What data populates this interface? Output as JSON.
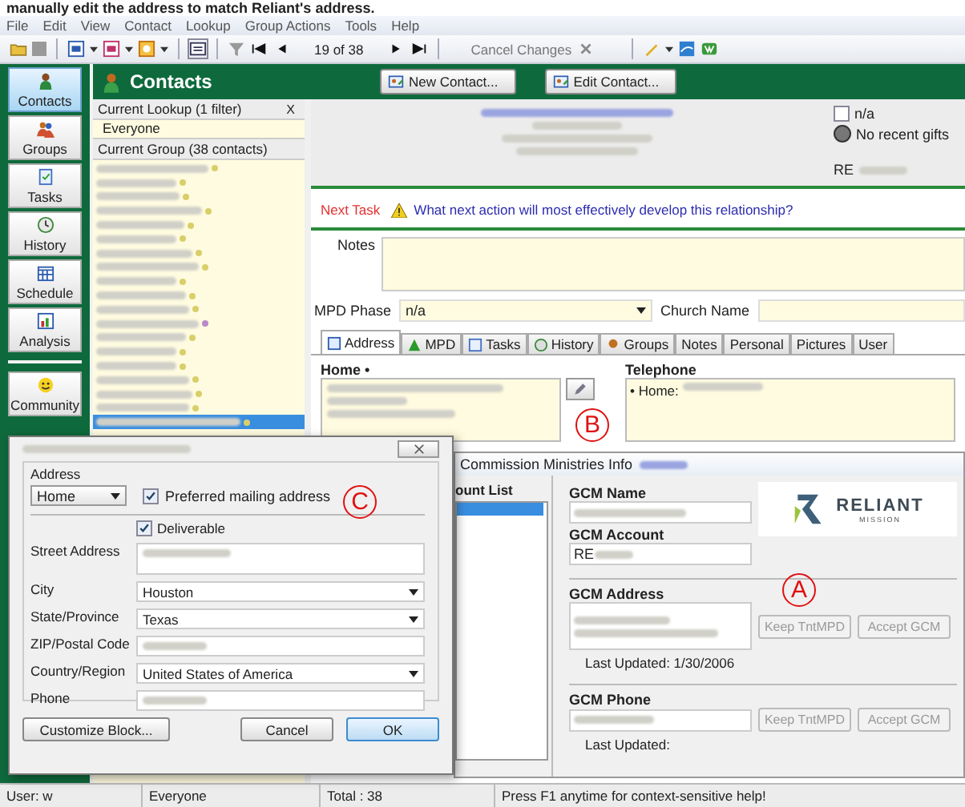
{
  "caption": "manually edit the address to match Reliant's address.",
  "menu": [
    "File",
    "Edit",
    "View",
    "Contact",
    "Lookup",
    "Group Actions",
    "Tools",
    "Help"
  ],
  "toolbar": {
    "record": "19 of 38",
    "cancel": "Cancel Changes"
  },
  "nav": [
    {
      "label": "Contacts",
      "selected": true
    },
    {
      "label": "Groups",
      "selected": false
    },
    {
      "label": "Tasks",
      "selected": false
    },
    {
      "label": "History",
      "selected": false
    },
    {
      "label": "Schedule",
      "selected": false
    },
    {
      "label": "Analysis",
      "selected": false
    },
    {
      "label": "Community",
      "selected": false
    }
  ],
  "header": {
    "title": "Contacts",
    "buttons": [
      "New Contact...",
      "Edit Contact..."
    ]
  },
  "lookup": {
    "title": "Current Lookup (1 filter)",
    "close": "X",
    "value": "Everyone",
    "group": "Current Group (38 contacts)",
    "rows": [
      {
        "color": "#d9cf6a",
        "selected": false
      },
      {
        "color": "#d9cf6a",
        "selected": false
      },
      {
        "color": "#d9cf6a",
        "selected": false
      },
      {
        "color": "#d9cf6a",
        "selected": false
      },
      {
        "color": "#d9cf6a",
        "selected": false
      },
      {
        "color": "#d9cf6a",
        "selected": false
      },
      {
        "color": "#d9cf6a",
        "selected": false
      },
      {
        "color": "#d9cf6a",
        "selected": false
      },
      {
        "color": "#d9cf6a",
        "selected": false
      },
      {
        "color": "#d9cf6a",
        "selected": false
      },
      {
        "color": "#d9cf6a",
        "selected": false
      },
      {
        "color": "#b98ac8",
        "selected": false
      },
      {
        "color": "#d9cf6a",
        "selected": false
      },
      {
        "color": "#d9cf6a",
        "selected": false
      },
      {
        "color": "#d9cf6a",
        "selected": false
      },
      {
        "color": "#d9cf6a",
        "selected": false
      },
      {
        "color": "#d9cf6a",
        "selected": false
      },
      {
        "color": "#d9cf6a",
        "selected": false
      },
      {
        "color": "#d9cf6a",
        "selected": true
      }
    ]
  },
  "summary": {
    "na_label": "n/a",
    "na_checked": false,
    "gifts": "No recent gifts",
    "account_prefix": "RE"
  },
  "next_task": {
    "label": "Next Task",
    "prompt": "What next action will most effectively develop this relationship?"
  },
  "notes_label": "Notes",
  "mpd": {
    "label": "MPD Phase",
    "value": "n/a",
    "church_label": "Church Name"
  },
  "tabs": [
    {
      "label": "Address",
      "selected": true
    },
    {
      "label": "MPD",
      "selected": false
    },
    {
      "label": "Tasks",
      "selected": false
    },
    {
      "label": "History",
      "selected": false
    },
    {
      "label": "Groups",
      "selected": false
    },
    {
      "label": "Notes",
      "selected": false
    },
    {
      "label": "Personal",
      "selected": false
    },
    {
      "label": "Pictures",
      "selected": false
    },
    {
      "label": "User",
      "selected": false
    }
  ],
  "address": {
    "heading": "Home •",
    "phone_heading": "Telephone",
    "phone_label": "• Home:"
  },
  "dialog": {
    "group_label": "Address",
    "type": "Home",
    "preferred": {
      "label": "Preferred mailing address",
      "checked": true
    },
    "deliverable": {
      "label": "Deliverable",
      "checked": true
    },
    "fields": [
      {
        "label": "Street Address",
        "kind": "multiline"
      },
      {
        "label": "City",
        "kind": "dropdown",
        "value": "Houston"
      },
      {
        "label": "State/Province",
        "kind": "dropdown",
        "value": "Texas"
      },
      {
        "label": "ZIP/Postal Code",
        "kind": "text"
      },
      {
        "label": "Country/Region",
        "kind": "dropdown",
        "value": "United States of America"
      },
      {
        "label": "Phone",
        "kind": "text"
      }
    ],
    "buttons": [
      "Customize Block...",
      "Cancel",
      "OK"
    ]
  },
  "gcm": {
    "title": "Commission Ministries Info",
    "list_title": "ount List",
    "name_label": "GCM Name",
    "account_label": "GCM Account",
    "account_prefix": "RE",
    "logo": "RELIANT",
    "logo_sub": "MISSION",
    "address_label": "GCM Address",
    "address_updated": "Last Updated:  1/30/2006",
    "address_buttons": [
      "Keep TntMPD",
      "Accept GCM"
    ],
    "phone_label": "GCM Phone",
    "phone_updated": "Last Updated:",
    "phone_buttons": [
      "Keep TntMPD",
      "Accept GCM"
    ]
  },
  "markers": {
    "a": "A",
    "b": "B",
    "c": "C"
  },
  "status": [
    "User: w",
    "Everyone",
    "Total : 38",
    "Press F1 anytime for context-sensitive help!"
  ]
}
